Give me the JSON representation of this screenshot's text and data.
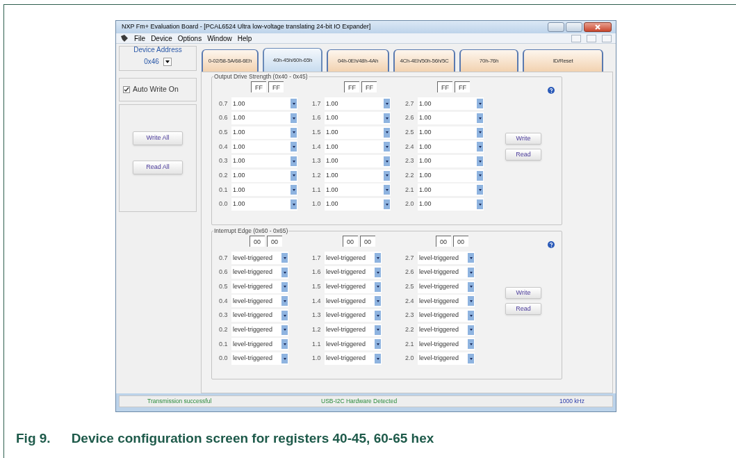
{
  "window": {
    "title": "NXP Fm+ Evaluation Board - [PCAL6524 Ultra low-voltage translating 24-bit IO Expander]"
  },
  "menu": [
    "File",
    "Device",
    "Options",
    "Window",
    "Help"
  ],
  "device_address": {
    "label": "Device Address",
    "value": "0x46"
  },
  "tabs": [
    {
      "label": "0-02/58-5A/68-6Eh",
      "selected": false
    },
    {
      "label": "40h-45h/60h-65h",
      "selected": true
    },
    {
      "label": "04h-0Eh/48h-4Ah",
      "selected": false
    },
    {
      "label": "4Ch-4Eh/50h-56h/5C",
      "selected": false
    },
    {
      "label": "70h-76h",
      "selected": false
    },
    {
      "label": "ID/Reset",
      "selected": false
    }
  ],
  "auto_write": {
    "label": "Auto Write On",
    "checked": true
  },
  "side_buttons": [
    "Write All",
    "Read All"
  ],
  "groups": [
    {
      "title": "Output Drive Strength (0x40 - 0x45)",
      "buttons": [
        "Write",
        "Read"
      ],
      "columns": [
        {
          "hex": [
            "FF",
            "FF"
          ],
          "rows": [
            {
              "bit": "0.7",
              "value": "1.00"
            },
            {
              "bit": "0.6",
              "value": "1.00"
            },
            {
              "bit": "0.5",
              "value": "1.00"
            },
            {
              "bit": "0.4",
              "value": "1.00"
            },
            {
              "bit": "0.3",
              "value": "1.00"
            },
            {
              "bit": "0.2",
              "value": "1.00"
            },
            {
              "bit": "0.1",
              "value": "1.00"
            },
            {
              "bit": "0.0",
              "value": "1.00"
            }
          ]
        },
        {
          "hex": [
            "FF",
            "FF"
          ],
          "rows": [
            {
              "bit": "1.7",
              "value": "1.00"
            },
            {
              "bit": "1.6",
              "value": "1.00"
            },
            {
              "bit": "1.5",
              "value": "1.00"
            },
            {
              "bit": "1.4",
              "value": "1.00"
            },
            {
              "bit": "1.3",
              "value": "1.00"
            },
            {
              "bit": "1.2",
              "value": "1.00"
            },
            {
              "bit": "1.1",
              "value": "1.00"
            },
            {
              "bit": "1.0",
              "value": "1.00"
            }
          ]
        },
        {
          "hex": [
            "FF",
            "FF"
          ],
          "rows": [
            {
              "bit": "2.7",
              "value": "1.00"
            },
            {
              "bit": "2.6",
              "value": "1.00"
            },
            {
              "bit": "2.5",
              "value": "1.00"
            },
            {
              "bit": "2.4",
              "value": "1.00"
            },
            {
              "bit": "2.3",
              "value": "1.00"
            },
            {
              "bit": "2.2",
              "value": "1.00"
            },
            {
              "bit": "2.1",
              "value": "1.00"
            },
            {
              "bit": "2.0",
              "value": "1.00"
            }
          ]
        }
      ]
    },
    {
      "title": "Interrupt Edge (0x60 - 0x65)",
      "buttons": [
        "Write",
        "Read"
      ],
      "columns": [
        {
          "hex": [
            "00",
            "00"
          ],
          "rows": [
            {
              "bit": "0.7",
              "value": "level-triggered"
            },
            {
              "bit": "0.6",
              "value": "level-triggered"
            },
            {
              "bit": "0.5",
              "value": "level-triggered"
            },
            {
              "bit": "0.4",
              "value": "level-triggered"
            },
            {
              "bit": "0.3",
              "value": "level-triggered"
            },
            {
              "bit": "0.2",
              "value": "level-triggered"
            },
            {
              "bit": "0.1",
              "value": "level-triggered"
            },
            {
              "bit": "0.0",
              "value": "level-triggered"
            }
          ]
        },
        {
          "hex": [
            "00",
            "00"
          ],
          "rows": [
            {
              "bit": "1.7",
              "value": "level-triggered"
            },
            {
              "bit": "1.6",
              "value": "level-triggered"
            },
            {
              "bit": "1.5",
              "value": "level-triggered"
            },
            {
              "bit": "1.4",
              "value": "level-triggered"
            },
            {
              "bit": "1.3",
              "value": "level-triggered"
            },
            {
              "bit": "1.2",
              "value": "level-triggered"
            },
            {
              "bit": "1.1",
              "value": "level-triggered"
            },
            {
              "bit": "1.0",
              "value": "level-triggered"
            }
          ]
        },
        {
          "hex": [
            "00",
            "00"
          ],
          "rows": [
            {
              "bit": "2.7",
              "value": "level-triggered"
            },
            {
              "bit": "2.6",
              "value": "level-triggered"
            },
            {
              "bit": "2.5",
              "value": "level-triggered"
            },
            {
              "bit": "2.4",
              "value": "level-triggered"
            },
            {
              "bit": "2.3",
              "value": "level-triggered"
            },
            {
              "bit": "2.2",
              "value": "level-triggered"
            },
            {
              "bit": "2.1",
              "value": "level-triggered"
            },
            {
              "bit": "2.0",
              "value": "level-triggered"
            }
          ]
        }
      ]
    }
  ],
  "status_bar": [
    "Transmission successful",
    "USB-I2C Hardware Detected",
    "1000 kHz"
  ],
  "caption": {
    "number": "Fig 9.",
    "text": "Device configuration screen for registers 40-45, 60-65 hex"
  }
}
